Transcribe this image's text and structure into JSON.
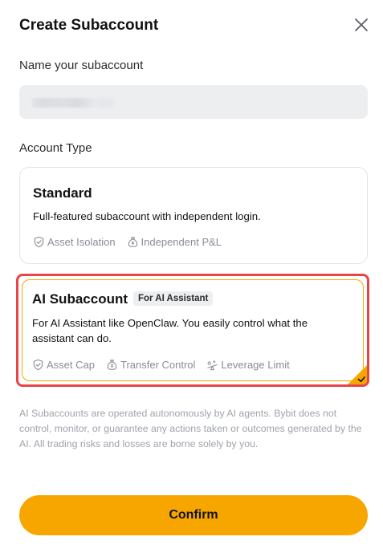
{
  "header": {
    "title": "Create Subaccount",
    "close_icon": "close-icon"
  },
  "name_field": {
    "label": "Name your subaccount",
    "value_redacted": true
  },
  "account_type": {
    "label": "Account Type",
    "options": [
      {
        "title": "Standard",
        "description": "Full-featured subaccount with independent login.",
        "features": [
          {
            "icon": "shield-check-icon",
            "label": "Asset Isolation"
          },
          {
            "icon": "money-bag-icon",
            "label": "Independent P&L"
          }
        ],
        "selected": false
      },
      {
        "title": "AI Subaccount",
        "badge": "For AI Assistant",
        "description": "For AI Assistant like OpenClaw. You easily control what the assistant can do.",
        "features": [
          {
            "icon": "shield-check-icon",
            "label": "Asset Cap"
          },
          {
            "icon": "money-bag-icon",
            "label": "Transfer Control"
          },
          {
            "icon": "leverage-icon",
            "label": "Leverage Limit"
          }
        ],
        "selected": true
      }
    ]
  },
  "disclaimer": "AI Subaccounts are operated autonomously by AI agents. Bybit does not control, monitor, or guarantee any actions taken or outcomes generated by the AI. All trading risks and losses are borne solely by you.",
  "confirm_label": "Confirm",
  "colors": {
    "accent": "#f7a600",
    "highlight_border": "#e8454b",
    "muted_text": "#a0a3ab",
    "feature_text": "#8a8d96"
  }
}
